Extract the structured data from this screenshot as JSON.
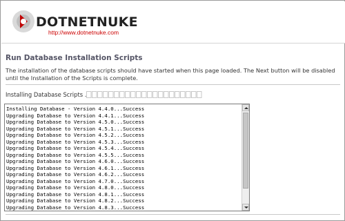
{
  "brand": {
    "name": "DOTNETNUKE",
    "url": "http://www.dotnetnuke.com",
    "accent": "#cc0000",
    "logo_icon": "dotnetnuke-logo-icon"
  },
  "page": {
    "title": "Run Database Installation Scripts",
    "description": "The installation of the database scripts should have started when this page loaded. The Next button will be disabled until the Installation of the Scripts is complete."
  },
  "progress": {
    "label": "Installing Database Scripts ...",
    "segments": 21,
    "filled": 0
  },
  "log": {
    "lines": [
      "Installing Database - Version 4.4.0...Success",
      "Upgrading Database to Version 4.4.1...Success",
      "Upgrading Database to Version 4.5.0...Success",
      "Upgrading Database to Version 4.5.1...Success",
      "Upgrading Database to Version 4.5.2...Success",
      "Upgrading Database to Version 4.5.3...Success",
      "Upgrading Database to Version 4.5.4...Success",
      "Upgrading Database to Version 4.5.5...Success",
      "Upgrading Database to Version 4.6.0...Success",
      "Upgrading Database to Version 4.6.1...Success",
      "Upgrading Database to Version 4.6.2...Success",
      "Upgrading Database to Version 4.7.0...Success",
      "Upgrading Database to Version 4.8.0...Success",
      "Upgrading Database to Version 4.8.1...Success",
      "Upgrading Database to Version 4.8.2...Success",
      "Upgrading Database to Version 4.8.3...Success"
    ]
  }
}
